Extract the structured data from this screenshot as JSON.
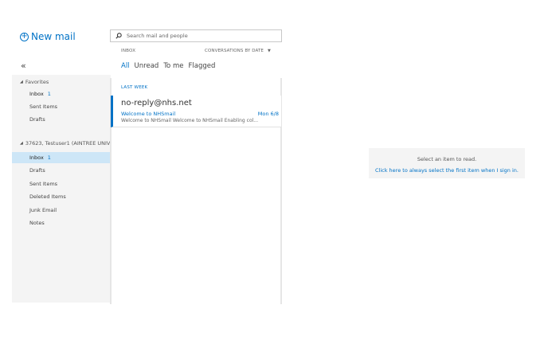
{
  "toolbar": {
    "new_mail_label": "New mail"
  },
  "nav": {
    "collapse_glyph": "«",
    "favorites_label": "Favorites",
    "favorites": [
      {
        "label": "Inbox",
        "count": "1"
      },
      {
        "label": "Sent Items"
      },
      {
        "label": "Drafts"
      }
    ],
    "account_label": "37623, Testuser1 (AINTREE UNIVER",
    "folders": [
      {
        "label": "Inbox",
        "count": "1"
      },
      {
        "label": "Drafts"
      },
      {
        "label": "Sent Items"
      },
      {
        "label": "Deleted Items"
      },
      {
        "label": "Junk Email"
      },
      {
        "label": "Notes"
      }
    ]
  },
  "search": {
    "placeholder": "Search mail and people"
  },
  "list": {
    "folder_name": "INBOX",
    "sort_label": "CONVERSATIONS BY DATE",
    "filters": [
      "All",
      "Unread",
      "To me",
      "Flagged"
    ],
    "group_header": "LAST WEEK",
    "messages": [
      {
        "sender": "no-reply@nhs.net",
        "subject": "Welcome to NHSmail",
        "date": "Mon 6/8",
        "preview": "Welcome to NHSmail Welcome to NHSmail Enabling col..."
      }
    ]
  },
  "reading_pane": {
    "title": "Select an item to read.",
    "link": "Click here to always select the first item when I sign in."
  },
  "colors": {
    "accent": "#0072c6",
    "selected_bg": "#cde6f7",
    "pane_bg": "#f4f4f4"
  },
  "icons": {
    "new_mail": "plus-circle-icon",
    "search": "search-icon",
    "sort": "caret-down-icon"
  }
}
